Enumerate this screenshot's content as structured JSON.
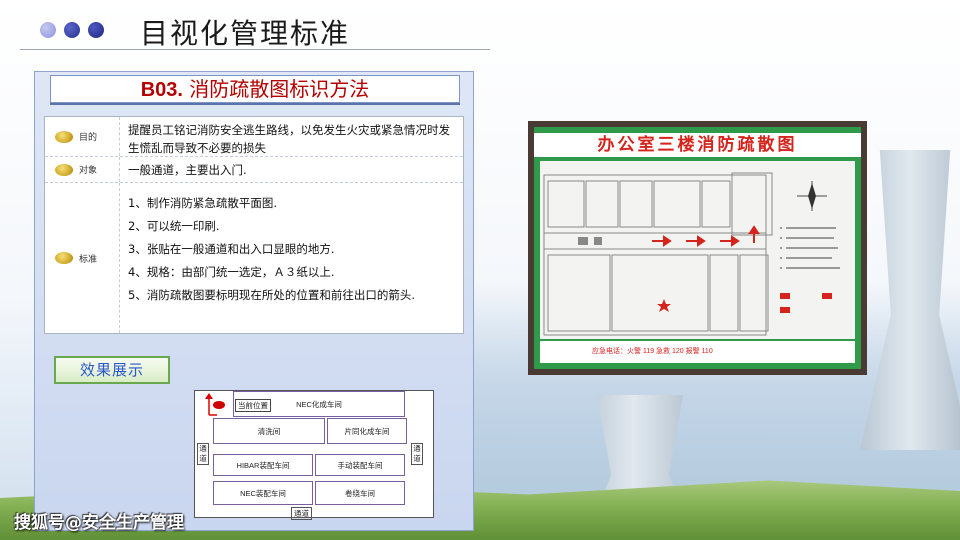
{
  "header": {
    "title": "目视化管理标准"
  },
  "section": {
    "code": "B03.",
    "name": " 消防疏散图标识方法"
  },
  "table": {
    "rows": [
      {
        "label": "目的",
        "text": "提醒员工铭记消防安全逃生路线，以免发生火灾或紧急情况时发生慌乱而导致不必要的损失"
      },
      {
        "label": "对象",
        "text": "一般通道，主要出入门."
      },
      {
        "label": "标准",
        "items": [
          "1、制作消防紧急疏散平面图.",
          "2、可以统一印刷.",
          "3、张贴在一般通道和出入口显眼的地方.",
          "4、规格：由部门统一选定，Ａ３纸以上.",
          "5、消防疏散图要标明现在所处的位置和前往出口的箭头."
        ]
      }
    ]
  },
  "effect_button": "效果展示",
  "floor_plan": {
    "current_position": "当前位置",
    "rooms": [
      "NEC化成车间",
      "清洗间",
      "片同化成车间",
      "HIBAR装配车间",
      "手动装配车间",
      "NEC装配车间",
      "卷绕车间"
    ],
    "corridor_left": "通道",
    "corridor_right": "通道",
    "corridor_bottom": "通道"
  },
  "sign": {
    "title": "办公室三楼消防疏散图",
    "footer": "应急电话：火警 119   急救 120   报警 110"
  },
  "watermark": "搜狐号@安全生产管理",
  "colors": {
    "title_red": "#b40000",
    "sign_green": "#2f9a4a",
    "sign_red": "#d4241c",
    "button_blue": "#2c57c9"
  }
}
